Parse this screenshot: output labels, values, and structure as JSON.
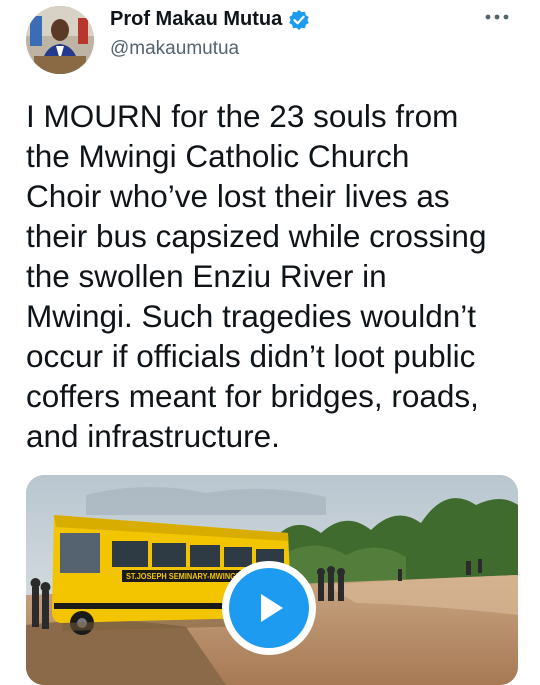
{
  "author": {
    "display_name": "Prof Makau Mutua",
    "handle": "@makaumutua",
    "verified": true,
    "avatar_icon": "profile-photo"
  },
  "menu": {
    "icon": "more-options-icon"
  },
  "tweet": {
    "text": "I MOURN for the 23 souls from\nthe Mwingi Catholic Church\nChoir who’ve lost their lives as\ntheir bus capsized while crossing\nthe swollen Enziu River in\nMwingi.  Such tragedies wouldn’t\noccur if officials didn’t loot public\ncoffers meant for bridges, roads,\nand infrastructure."
  },
  "media": {
    "type": "video",
    "bus_label": "ST.JOSEPH SEMINARY-MWINGI",
    "play_icon": "play-icon"
  },
  "colors": {
    "accent": "#1d9bf0",
    "text": "#0f1419",
    "secondary": "#536471",
    "bus_yellow": "#f2c500"
  }
}
